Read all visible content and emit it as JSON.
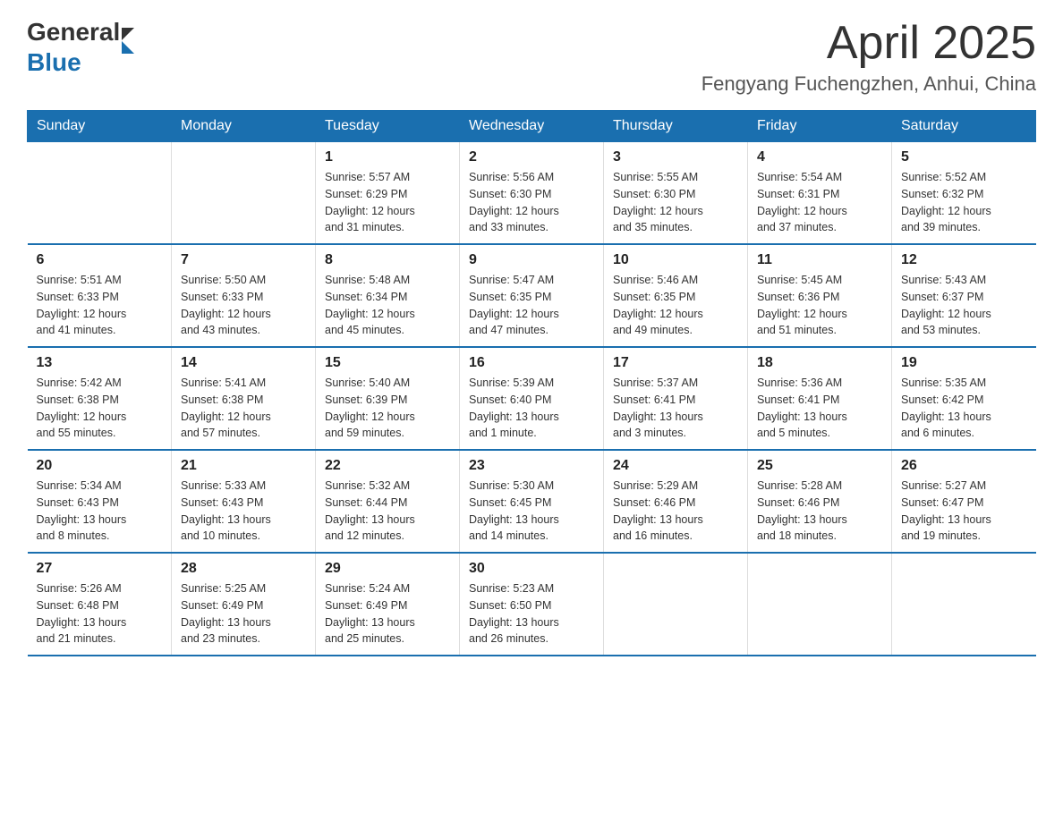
{
  "header": {
    "logo_general": "General",
    "logo_blue": "Blue",
    "month_title": "April 2025",
    "location": "Fengyang Fuchengzhen, Anhui, China"
  },
  "weekdays": [
    "Sunday",
    "Monday",
    "Tuesday",
    "Wednesday",
    "Thursday",
    "Friday",
    "Saturday"
  ],
  "weeks": [
    [
      {
        "day": "",
        "info": ""
      },
      {
        "day": "",
        "info": ""
      },
      {
        "day": "1",
        "info": "Sunrise: 5:57 AM\nSunset: 6:29 PM\nDaylight: 12 hours\nand 31 minutes."
      },
      {
        "day": "2",
        "info": "Sunrise: 5:56 AM\nSunset: 6:30 PM\nDaylight: 12 hours\nand 33 minutes."
      },
      {
        "day": "3",
        "info": "Sunrise: 5:55 AM\nSunset: 6:30 PM\nDaylight: 12 hours\nand 35 minutes."
      },
      {
        "day": "4",
        "info": "Sunrise: 5:54 AM\nSunset: 6:31 PM\nDaylight: 12 hours\nand 37 minutes."
      },
      {
        "day": "5",
        "info": "Sunrise: 5:52 AM\nSunset: 6:32 PM\nDaylight: 12 hours\nand 39 minutes."
      }
    ],
    [
      {
        "day": "6",
        "info": "Sunrise: 5:51 AM\nSunset: 6:33 PM\nDaylight: 12 hours\nand 41 minutes."
      },
      {
        "day": "7",
        "info": "Sunrise: 5:50 AM\nSunset: 6:33 PM\nDaylight: 12 hours\nand 43 minutes."
      },
      {
        "day": "8",
        "info": "Sunrise: 5:48 AM\nSunset: 6:34 PM\nDaylight: 12 hours\nand 45 minutes."
      },
      {
        "day": "9",
        "info": "Sunrise: 5:47 AM\nSunset: 6:35 PM\nDaylight: 12 hours\nand 47 minutes."
      },
      {
        "day": "10",
        "info": "Sunrise: 5:46 AM\nSunset: 6:35 PM\nDaylight: 12 hours\nand 49 minutes."
      },
      {
        "day": "11",
        "info": "Sunrise: 5:45 AM\nSunset: 6:36 PM\nDaylight: 12 hours\nand 51 minutes."
      },
      {
        "day": "12",
        "info": "Sunrise: 5:43 AM\nSunset: 6:37 PM\nDaylight: 12 hours\nand 53 minutes."
      }
    ],
    [
      {
        "day": "13",
        "info": "Sunrise: 5:42 AM\nSunset: 6:38 PM\nDaylight: 12 hours\nand 55 minutes."
      },
      {
        "day": "14",
        "info": "Sunrise: 5:41 AM\nSunset: 6:38 PM\nDaylight: 12 hours\nand 57 minutes."
      },
      {
        "day": "15",
        "info": "Sunrise: 5:40 AM\nSunset: 6:39 PM\nDaylight: 12 hours\nand 59 minutes."
      },
      {
        "day": "16",
        "info": "Sunrise: 5:39 AM\nSunset: 6:40 PM\nDaylight: 13 hours\nand 1 minute."
      },
      {
        "day": "17",
        "info": "Sunrise: 5:37 AM\nSunset: 6:41 PM\nDaylight: 13 hours\nand 3 minutes."
      },
      {
        "day": "18",
        "info": "Sunrise: 5:36 AM\nSunset: 6:41 PM\nDaylight: 13 hours\nand 5 minutes."
      },
      {
        "day": "19",
        "info": "Sunrise: 5:35 AM\nSunset: 6:42 PM\nDaylight: 13 hours\nand 6 minutes."
      }
    ],
    [
      {
        "day": "20",
        "info": "Sunrise: 5:34 AM\nSunset: 6:43 PM\nDaylight: 13 hours\nand 8 minutes."
      },
      {
        "day": "21",
        "info": "Sunrise: 5:33 AM\nSunset: 6:43 PM\nDaylight: 13 hours\nand 10 minutes."
      },
      {
        "day": "22",
        "info": "Sunrise: 5:32 AM\nSunset: 6:44 PM\nDaylight: 13 hours\nand 12 minutes."
      },
      {
        "day": "23",
        "info": "Sunrise: 5:30 AM\nSunset: 6:45 PM\nDaylight: 13 hours\nand 14 minutes."
      },
      {
        "day": "24",
        "info": "Sunrise: 5:29 AM\nSunset: 6:46 PM\nDaylight: 13 hours\nand 16 minutes."
      },
      {
        "day": "25",
        "info": "Sunrise: 5:28 AM\nSunset: 6:46 PM\nDaylight: 13 hours\nand 18 minutes."
      },
      {
        "day": "26",
        "info": "Sunrise: 5:27 AM\nSunset: 6:47 PM\nDaylight: 13 hours\nand 19 minutes."
      }
    ],
    [
      {
        "day": "27",
        "info": "Sunrise: 5:26 AM\nSunset: 6:48 PM\nDaylight: 13 hours\nand 21 minutes."
      },
      {
        "day": "28",
        "info": "Sunrise: 5:25 AM\nSunset: 6:49 PM\nDaylight: 13 hours\nand 23 minutes."
      },
      {
        "day": "29",
        "info": "Sunrise: 5:24 AM\nSunset: 6:49 PM\nDaylight: 13 hours\nand 25 minutes."
      },
      {
        "day": "30",
        "info": "Sunrise: 5:23 AM\nSunset: 6:50 PM\nDaylight: 13 hours\nand 26 minutes."
      },
      {
        "day": "",
        "info": ""
      },
      {
        "day": "",
        "info": ""
      },
      {
        "day": "",
        "info": ""
      }
    ]
  ]
}
